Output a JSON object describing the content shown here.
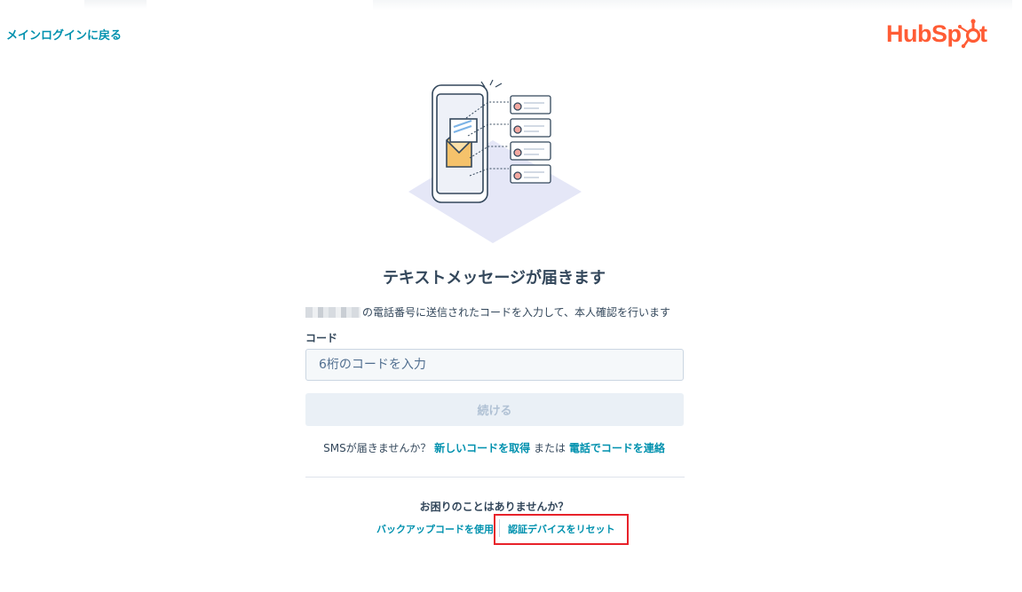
{
  "header": {
    "back_link": "メインログインに戻る",
    "brand": "HubSpot"
  },
  "main": {
    "title": "テキストメッセージが届きます",
    "description": "の電話番号に送信されたコードを入力して、本人確認を行います",
    "code_label": "コード",
    "code_placeholder": "6桁のコードを入力",
    "code_value": "",
    "continue_label": "続ける"
  },
  "sms": {
    "prompt": "SMSが届きませんか？",
    "new_code_link": "新しいコードを取得",
    "or_text": "または",
    "call_link": "電話でコードを連絡"
  },
  "help": {
    "title": "お困りのことはありませんか？",
    "backup_link": "バックアップコードを使用",
    "reset_link": "認証デバイスをリセット"
  },
  "colors": {
    "link": "#0091ae",
    "text": "#33475b",
    "brand_orange": "#ff5c35",
    "highlight": "#e8222a",
    "disabled_button_bg": "#eaf0f6"
  },
  "icons": [
    "phone-envelope-illustration",
    "hubspot-sprocket-icon"
  ]
}
